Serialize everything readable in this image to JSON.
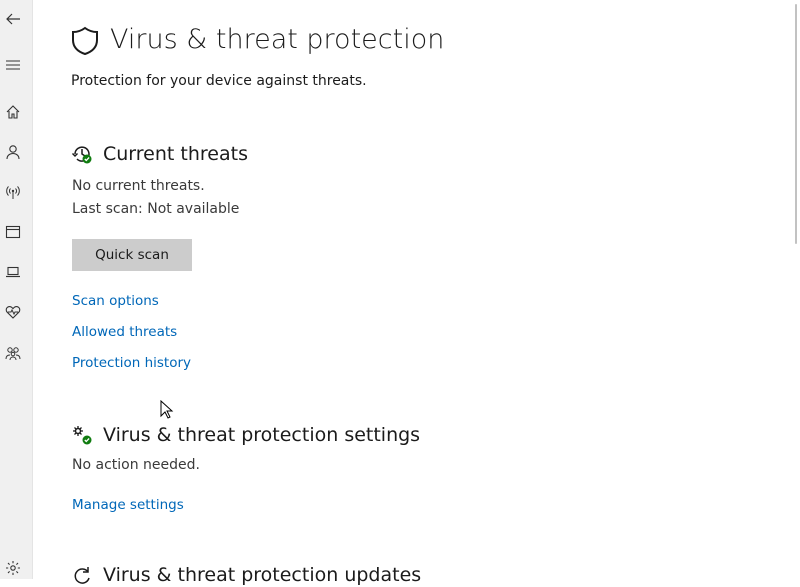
{
  "page": {
    "title": "Virus & threat protection",
    "subtitle": "Protection for your device against threats.",
    "title_icon": "shield-icon"
  },
  "nav_rail": [
    {
      "icon": "back-arrow-icon"
    },
    {
      "icon": "hamburger-menu-icon"
    },
    {
      "icon": "home-icon"
    },
    {
      "icon": "account-icon"
    },
    {
      "icon": "network-icon"
    },
    {
      "icon": "app-browser-icon"
    },
    {
      "icon": "device-security-icon"
    },
    {
      "icon": "health-heart-icon"
    },
    {
      "icon": "family-icon"
    },
    {
      "icon": "settings-gear-icon"
    }
  ],
  "current_threats": {
    "heading": "Current threats",
    "status": "No current threats.",
    "last_scan": "Last scan: Not available",
    "quick_scan_label": "Quick scan",
    "links": [
      "Scan options",
      "Allowed threats",
      "Protection history"
    ]
  },
  "protection_settings": {
    "heading": "Virus & threat protection settings",
    "status": "No action needed.",
    "manage_link": "Manage settings"
  },
  "protection_updates": {
    "heading": "Virus & threat protection updates"
  },
  "colors": {
    "accent_link": "#0067b8",
    "ok_green": "#107c10",
    "button_gray": "#cccccc",
    "rail_bg": "#f0f0f0"
  }
}
